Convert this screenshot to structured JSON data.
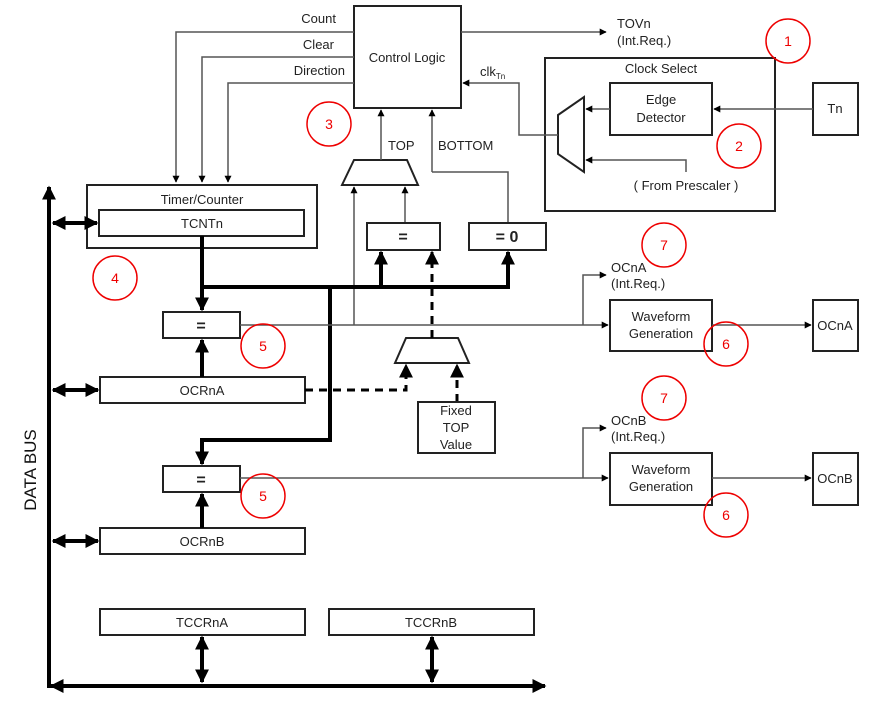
{
  "diagram": {
    "control_logic": "Control Logic",
    "signals": {
      "count": "Count",
      "clear": "Clear",
      "direction": "Direction",
      "top": "TOP",
      "bottom": "BOTTOM",
      "clk": "clk",
      "clk_sub": "Tn"
    },
    "tovn": {
      "name": "TOVn",
      "req": "(Int.Req.)"
    },
    "clock_select": {
      "title": "Clock Select",
      "edge1": "Edge",
      "edge2": "Detector",
      "prescaler": "( From Prescaler )",
      "tn": "Tn"
    },
    "timer_counter": {
      "title": "Timer/Counter",
      "register": "TCNTn"
    },
    "comparators": {
      "eq": "=",
      "eq0": "= 0"
    },
    "fixed_top": [
      "Fixed",
      "TOP",
      "Value"
    ],
    "registers": {
      "ocrna": "OCRnA",
      "ocrnb": "OCRnB",
      "tccrna": "TCCRnA",
      "tccrnb": "TCCRnB"
    },
    "outputs": {
      "a": {
        "flag": "OCnA",
        "req": "(Int.Req.)",
        "wave1": "Waveform",
        "wave2": "Generation",
        "pin": "OCnA"
      },
      "b": {
        "flag": "OCnB",
        "req": "(Int.Req.)",
        "wave1": "Waveform",
        "wave2": "Generation",
        "pin": "OCnB"
      }
    },
    "data_bus": "DATA BUS",
    "annotations": [
      "1",
      "2",
      "3",
      "4",
      "5",
      "5",
      "6",
      "6",
      "7",
      "7"
    ],
    "annotation_color": "#e00000"
  }
}
